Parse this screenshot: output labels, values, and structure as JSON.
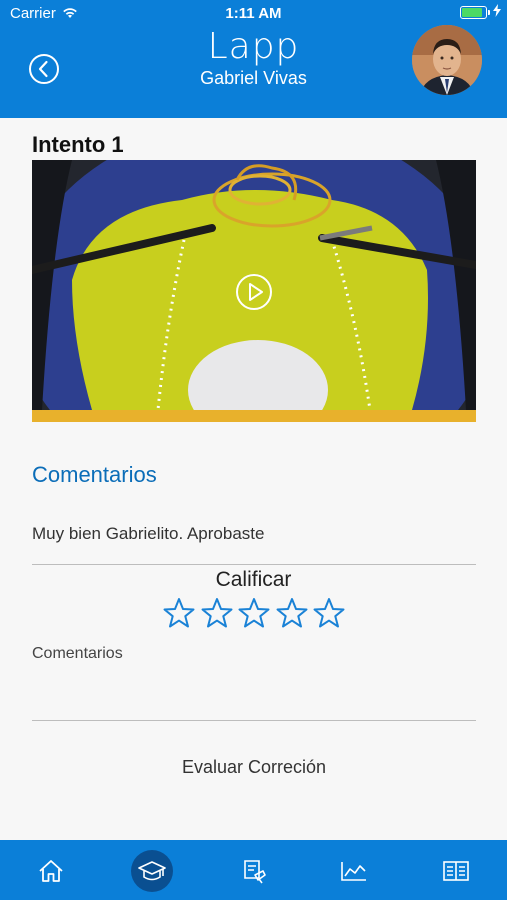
{
  "status_bar": {
    "carrier": "Carrier",
    "time": "1:11 AM"
  },
  "header": {
    "app_title": "Lapp",
    "user_name": "Gabriel Vivas",
    "back_icon": "chevron-left-circle-icon",
    "avatar": "user-avatar-photo"
  },
  "attempt": {
    "title": "Intento 1",
    "video_icon": "play-icon"
  },
  "comments": {
    "heading": "Comentarios",
    "text": "Muy bien Gabrielito. Aprobaste"
  },
  "rating": {
    "label": "Calificar",
    "stars": 5,
    "selected": 0
  },
  "form": {
    "comments_placeholder": "Comentarios",
    "evaluate_label": "Evaluar Correción"
  },
  "tabbar": {
    "items": [
      "home-icon",
      "graduation-cap-icon",
      "exam-icon",
      "chart-icon",
      "book-icon"
    ],
    "active_index": 1
  },
  "colors": {
    "primary": "#0b7fd8",
    "active_tab": "#0a4f91",
    "heading_blue": "#0b6db8",
    "star_blue": "#1a82d6"
  }
}
